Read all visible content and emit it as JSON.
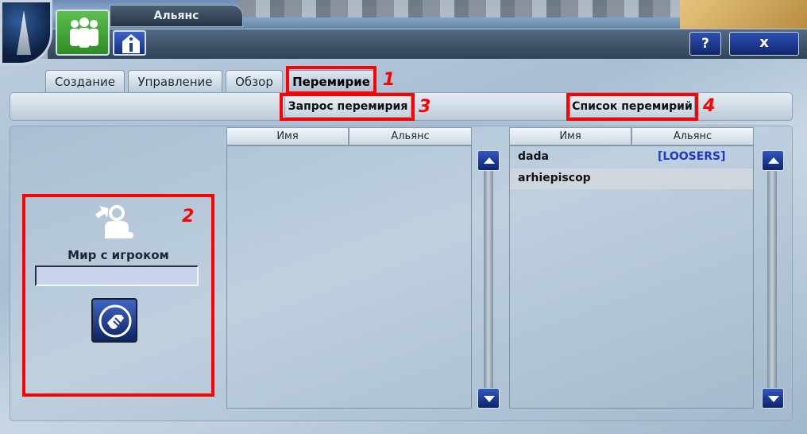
{
  "window": {
    "title": "Альянс",
    "help_label": "?",
    "close_label": "x"
  },
  "tabs": [
    {
      "label": "Создание"
    },
    {
      "label": "Управление"
    },
    {
      "label": "Обзор"
    },
    {
      "label": "Перемирие",
      "active": true
    }
  ],
  "sub_buttons": {
    "request_label": "Запрос перемирия",
    "list_label": "Список перемирий"
  },
  "annotations": [
    "1",
    "2",
    "3",
    "4"
  ],
  "peace_panel": {
    "label": "Мир с игроком",
    "input_value": ""
  },
  "left_table": {
    "columns": [
      "Имя",
      "Альянс"
    ],
    "rows": []
  },
  "right_table": {
    "columns": [
      "Имя",
      "Альянс"
    ],
    "rows": [
      {
        "name": "dada",
        "alliance": "[LOOSERS]"
      },
      {
        "name": "arhiepiscop",
        "alliance": "",
        "selected": true
      }
    ]
  },
  "colors": {
    "annotation_red": "#ff0000",
    "alliance_tag_blue": "#1f3ac9",
    "button_blue": "#10266d",
    "group_tab_green": "#2d8c25"
  },
  "icons": [
    "group-icon",
    "info-icon",
    "help-icon",
    "close-icon",
    "user-peace-icon",
    "handshake-icon",
    "scroll-up-icon",
    "scroll-down-icon"
  ]
}
